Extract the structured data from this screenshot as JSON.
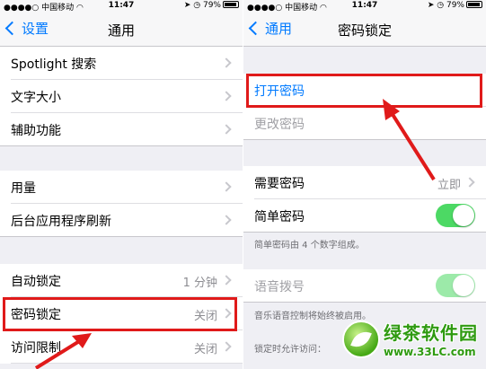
{
  "status_bar": {
    "carrier": "中国移动",
    "time": "11:47",
    "battery": "79%"
  },
  "left": {
    "back_label": "设置",
    "title": "通用",
    "group1": [
      {
        "label": "Spotlight 搜索"
      },
      {
        "label": "文字大小"
      },
      {
        "label": "辅助功能"
      }
    ],
    "group2": [
      {
        "label": "用量"
      },
      {
        "label": "后台应用程序刷新"
      }
    ],
    "group3": [
      {
        "label": "自动锁定",
        "value": "1 分钟"
      },
      {
        "label": "密码锁定",
        "value": "关闭"
      },
      {
        "label": "访问限制",
        "value": "关闭"
      }
    ]
  },
  "right": {
    "back_label": "通用",
    "title": "密码锁定",
    "group1": [
      {
        "label": "打开密码"
      },
      {
        "label": "更改密码"
      }
    ],
    "group2": [
      {
        "label": "需要密码",
        "value": "立即"
      },
      {
        "label": "简单密码"
      }
    ],
    "simple_footer": "简单密码由 4 个数字组成。",
    "voice_dial": {
      "label": "语音拨号"
    },
    "voice_footer": "音乐语音控制将始终被启用。",
    "lock_footer": "锁定时允许访问："
  },
  "watermark": {
    "title": "绿茶软件园",
    "url": "www.33LC.com"
  },
  "colors": {
    "accent": "#007aff",
    "toggle_on": "#4cd964",
    "highlight": "#e01a1a",
    "background": "#efeff4"
  }
}
